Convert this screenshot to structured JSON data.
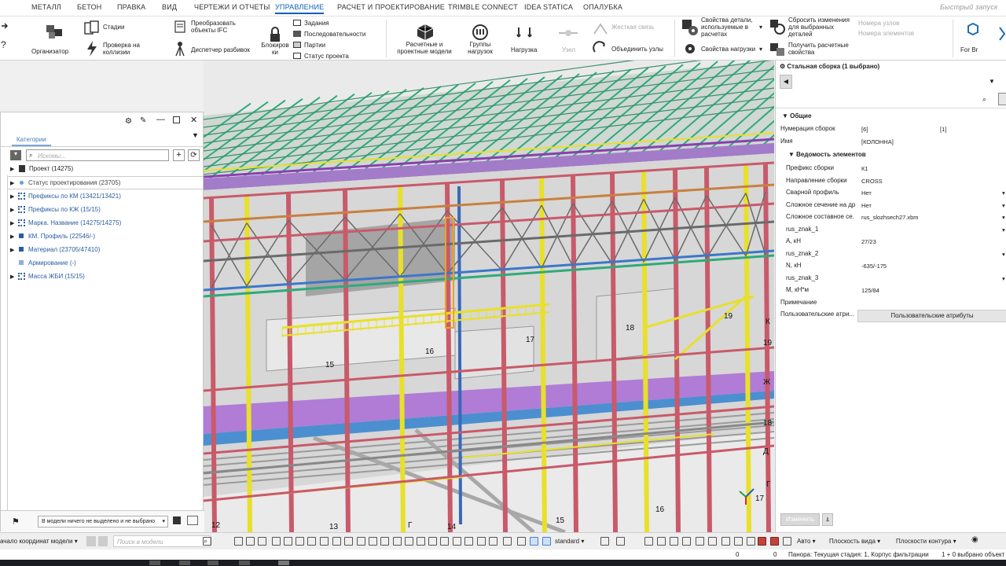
{
  "menu": {
    "items": [
      "МЕТАЛЛ",
      "БЕТОН",
      "ПРАВКА",
      "ВИД",
      "ЧЕРТЕЖИ И ОТЧЕТЫ",
      "УПРАВЛЕНИЕ",
      "РАСЧЕТ И ПРОЕКТИРОВАНИЕ",
      "TRIMBLE CONNECT",
      "IDEA STATICA",
      "ОПАЛУБКА"
    ],
    "active_index": 5,
    "quick_launch": "Быстрый запуск"
  },
  "ribbon": {
    "organizer": "Организатор",
    "stages": "Стадии",
    "clash_check": "Проверка на коллизии",
    "convert_ifc": "Преобразовать объекты IFC",
    "split_manager": "Диспетчер разбивок",
    "lock": "Блокиров ки",
    "tasks": "Задания",
    "sequences": "Последовательности",
    "lots": "Партии",
    "project_status": "Статус проекта",
    "analysis_models": "Расчетные и проектные модели",
    "load_groups": "Группы нагрузок",
    "load": "Нагрузка",
    "node": "Узел",
    "rigid_link": "Жесткая связь",
    "merge_nodes": "Объединить узлы",
    "part_props": "Свойства детали, используемые в расчетах",
    "load_props": "Свойства нагрузки",
    "reset_changes": "Сбросить изменения для выбранных деталей",
    "get_props": "Получить расчетные свойства",
    "node_numbers": "Номера узлов",
    "element_numbers": "Номера элементов",
    "for_br": "For Br"
  },
  "left_panel": {
    "tab": "Категории",
    "search_placeholder": "Искомы...",
    "tree": [
      {
        "label": "Проект (14275)",
        "color": "#222"
      },
      {
        "label": "Статус проектирования (23705)",
        "color": "#444"
      },
      {
        "label": "Префиксы по КМ (13421/13421)",
        "color": "#2a5d9e"
      },
      {
        "label": "Префиксы по КЖ (15/15)",
        "color": "#2a5d9e"
      },
      {
        "label": "Марка. Название (14275/14275)",
        "color": "#2a5d9e"
      },
      {
        "label": "КМ. Профиль (22546/-)",
        "color": "#2a5d9e"
      },
      {
        "label": "Материал (23705/47410)",
        "color": "#2a5d9e"
      },
      {
        "label": "Армирование (-)",
        "color": "#2a5d9e"
      },
      {
        "label": "Масса ЖБИ (15/15)",
        "color": "#2a5d9e"
      }
    ],
    "footer_select": "В модели ничего не выделено и не выбрано"
  },
  "right_panel": {
    "title": "Стальная сборка (1 выбрано)",
    "section_general": "Общие",
    "assembly_numbering_label": "Нумерация сборок",
    "assembly_numbering_val1": "[6]",
    "assembly_numbering_val2": "[1]",
    "name_label": "Имя",
    "name_val": "[КОЛОННА]",
    "section_elements": "Ведомость элементов",
    "rows": [
      {
        "label": "Префикс сборки",
        "value": "К1"
      },
      {
        "label": "Направление сборки",
        "value": "CROSS"
      },
      {
        "label": "Сварной профиль",
        "value": "Нет"
      },
      {
        "label": "Сложное сечение на др",
        "value": "Нет"
      },
      {
        "label": "Сложное составное се.",
        "value": "rus_slozhsech27.xbm"
      },
      {
        "label": "rus_znak_1",
        "value": ""
      },
      {
        "label": "А, кН",
        "value": "27/23"
      },
      {
        "label": "rus_znak_2",
        "value": ""
      },
      {
        "label": "N, кН",
        "value": "-635/-175"
      },
      {
        "label": "rus_znak_3",
        "value": ""
      },
      {
        "label": "М, кН*м",
        "value": "125/84"
      }
    ],
    "note_label": "Примечание",
    "user_attr_label": "Пользовательские атри...",
    "user_attr_button": "Пользовательские атрибуты",
    "modify_button": "Изменить"
  },
  "viewport_labels": [
    "15",
    "16",
    "17",
    "18",
    "19",
    "К",
    "Ж",
    "Д",
    "Г",
    "12",
    "13",
    "14",
    "15",
    "16",
    "17",
    "18",
    "19",
    "Г"
  ],
  "status_bar": {
    "coord_system": "ачало координат модели",
    "search_placeholder": "Поиск в модели",
    "standard": "standard",
    "auto": "Авто",
    "view_plane": "Плоскость вида",
    "contour_plane": "Плоскости контура"
  },
  "info_bar": {
    "zero1": "0",
    "zero2": "0",
    "text": "Панора: Текущая стадия: 1, Корпус фильтрации",
    "selection": "1 + 0 выбрано объект"
  },
  "colors": {
    "accent": "#0a5fb4",
    "steel_red": "#c85a6a",
    "steel_yellow": "#e8e02a",
    "steel_green": "#2faa7a",
    "steel_purple": "#8a3fb0",
    "steel_blue": "#3a78c8",
    "concrete": "#d8d8d8"
  }
}
